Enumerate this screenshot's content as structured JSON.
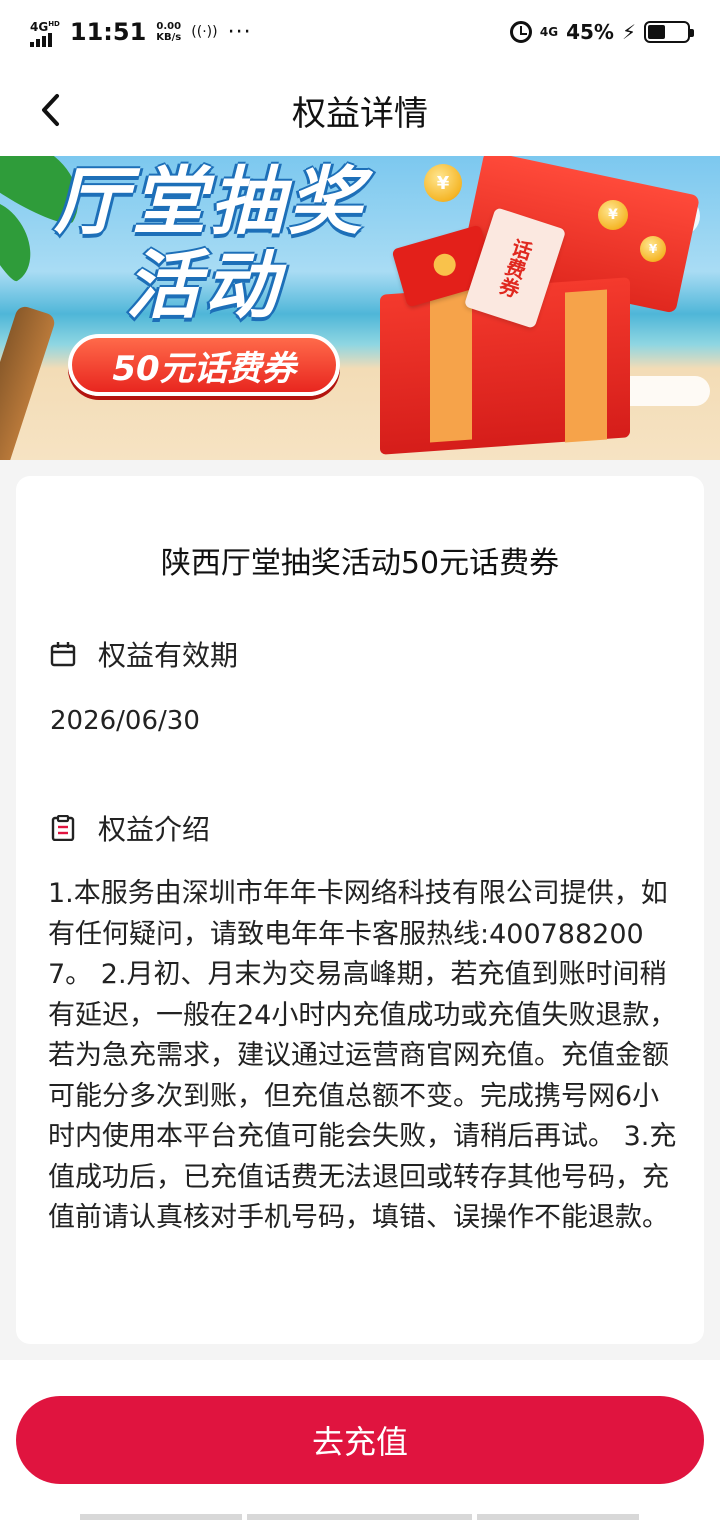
{
  "status_bar": {
    "network_type": "4G",
    "network_sup": "HD",
    "time": "11:51",
    "speed_value": "0.00",
    "speed_unit": "KB/s",
    "more": "···",
    "right_network": "4G",
    "battery_percent": "45%",
    "battery_level": 0.45
  },
  "header": {
    "title": "权益详情",
    "back_icon": "chevron-left-icon"
  },
  "banner": {
    "title_line1": "厅堂抽奖",
    "title_line2": "活动",
    "pill_text": "50元话费券",
    "ticket_text": "话费券",
    "coin_symbol": "¥",
    "colors": {
      "sky": "#7cc8ef",
      "sand": "#f6e3c3",
      "gift_red": "#e0281f",
      "ribbon": "#f6a34a"
    }
  },
  "card": {
    "title": "陕西厅堂抽奖活动50元话费券",
    "validity": {
      "icon": "calendar-icon",
      "label": "权益有效期",
      "date": "2026/06/30"
    },
    "intro": {
      "icon": "clipboard-icon",
      "label": "权益介绍",
      "text": "1.本服务由深圳市年年卡网络科技有限公司提供，如有任何疑问，请致电年年卡客服热线:4007882007。 2.月初、月末为交易高峰期，若充值到账时间稍有延迟，一般在24小时内充值成功或充值失败退款，若为急充需求，建议通过运营商官网充值。充值金额可能分多次到账，但充值总额不变。完成携号网6小时内使用本平台充值可能会失败，请稍后再试。 3.充值成功后，已充值话费无法退回或转存其他号码，充值前请认真核对手机号码，填错、误操作不能退款。"
    }
  },
  "action": {
    "recharge_label": "去充值",
    "color": "#e0143f"
  }
}
